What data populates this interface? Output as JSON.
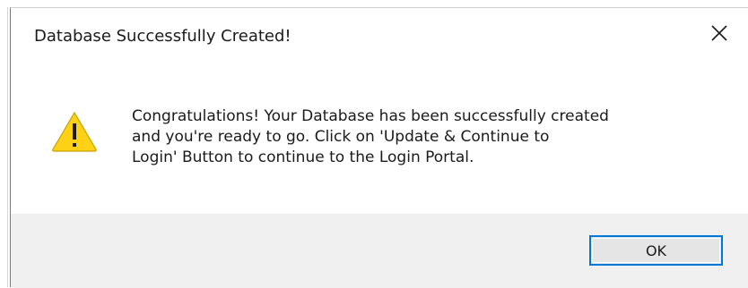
{
  "dialog": {
    "title": "Database Successfully Created!",
    "close_icon": "close-icon",
    "warning_icon": "warning-icon",
    "message_lines": [
      "Congratulations! Your Database has been successfully created",
      "and you're ready to go. Click on 'Update & Continue to",
      "Login' Button to continue to the Login Portal."
    ],
    "ok_label": "OK"
  },
  "colors": {
    "accent": "#0078d7",
    "warning_fill": "#fcd116",
    "footer_bg": "#f0f0f0"
  }
}
